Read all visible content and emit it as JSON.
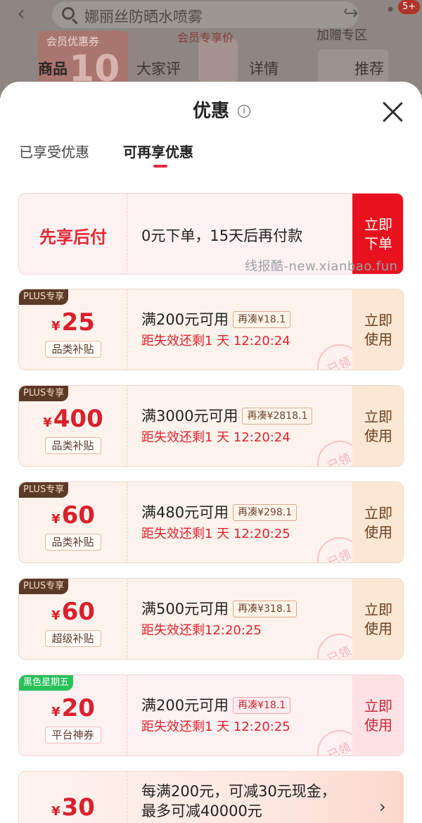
{
  "background": {
    "search_text": "娜丽丝防晒水喷雾",
    "notification_badge": "5+",
    "member_coupon_label": "会员优惠券",
    "member_coupon_value": "10",
    "member_price_label": "会员专享价",
    "gift_zone_label": "加赠专区",
    "tabs": [
      "商品",
      "大家评",
      "详情",
      "推荐"
    ]
  },
  "sheet": {
    "title": "优惠",
    "tab_enjoyed": "已享受优惠",
    "tab_more": "可再享优惠"
  },
  "pay_later": {
    "title": "先享后付",
    "description": "0元下单，15天后再付款",
    "button": "立即下单"
  },
  "watermark": "线报酷-new.xianbao.fun",
  "coupons": [
    {
      "tag": "PLUS专享",
      "amount": "25",
      "type": "品类补贴",
      "condition": "满200元可用",
      "more": "再凑¥18.1",
      "expire": "距失效还剩1 天 12:20:24",
      "button": "立即使用",
      "stamp": "已领"
    },
    {
      "tag": "PLUS专享",
      "amount": "400",
      "type": "品类补贴",
      "condition": "满3000元可用",
      "more": "再凑¥2818.1",
      "expire": "距失效还剩1 天 12:20:24",
      "button": "立即使用",
      "stamp": "已领"
    },
    {
      "tag": "PLUS专享",
      "amount": "60",
      "type": "品类补贴",
      "condition": "满480元可用",
      "more": "再凑¥298.1",
      "expire": "距失效还剩1 天 12:20:25",
      "button": "立即使用",
      "stamp": "已领"
    },
    {
      "tag": "PLUS专享",
      "amount": "60",
      "type": "超级补贴",
      "condition": "满500元可用",
      "more": "再凑¥318.1",
      "expire": "距失效还剩12:20:25",
      "button": "立即使用",
      "stamp": "已领"
    },
    {
      "tag": "黑色星期五",
      "amount": "20",
      "type": "平台神券",
      "condition": "满200元可用",
      "more": "再凑¥18.1",
      "expire": "距失效还剩1 天 12:20:25",
      "button": "立即使用",
      "stamp": "已领"
    }
  ],
  "cash_offer": {
    "amount": "30",
    "line1": "每满200元，可减30元现金，",
    "line2": "最多可减40000元"
  },
  "currency_symbol": "¥",
  "colors": {
    "accent_red": "#e8121f",
    "price_red": "#d9202c",
    "plus_brown": "#5b3a2a",
    "black_friday_green": "#29c15a"
  }
}
